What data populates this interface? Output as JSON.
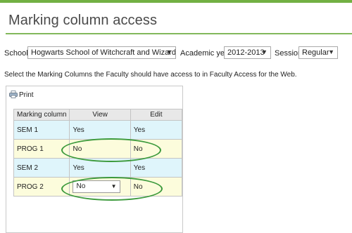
{
  "header": {
    "title": "Marking column access"
  },
  "filters": {
    "school_label": "School:",
    "school_value": "Hogwarts School of Witchcraft and Wizardry",
    "year_label": "Academic year:",
    "year_value": "2012-2013",
    "session_label": "Session:",
    "session_value": "Regular"
  },
  "instruction": "Select the Marking Columns the Faculty should have access to in Faculty Access for the Web.",
  "toolbar": {
    "print_label": "Print"
  },
  "table": {
    "headers": [
      "Marking column",
      "View",
      "Edit"
    ],
    "rows": [
      {
        "column": "SEM 1",
        "view": "Yes",
        "edit": "Yes"
      },
      {
        "column": "PROG 1",
        "view": "No",
        "edit": "No"
      },
      {
        "column": "SEM 2",
        "view": "Yes",
        "edit": "Yes"
      },
      {
        "column": "PROG 2",
        "view": "No",
        "edit": "No"
      }
    ]
  },
  "colors": {
    "accent_green": "#72b043",
    "row_blue": "#dff5fb",
    "row_yellow": "#fcfcdc",
    "highlight_ring": "#3c9a3c"
  },
  "icons": {
    "print": "printer-icon",
    "dropdown": "chevron-down-icon"
  }
}
